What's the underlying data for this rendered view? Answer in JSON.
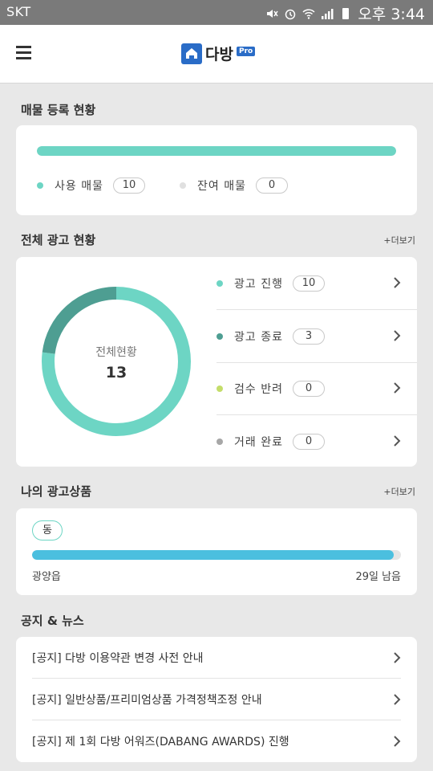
{
  "status_bar": {
    "carrier": "SKT",
    "time": "오후 3:44"
  },
  "header": {
    "logo_text": "다방",
    "logo_badge": "Pro"
  },
  "listing_status": {
    "title": "매물 등록 현황",
    "used_ratio": 1.0,
    "used": {
      "label": "사용 매물",
      "count": "10",
      "color": "#6dd5c4"
    },
    "remaining": {
      "label": "잔여 매물",
      "count": "0",
      "color": "#e0e0e0"
    }
  },
  "ad_status": {
    "title": "전체 광고 현황",
    "more": "+더보기",
    "center_label": "전체현황",
    "total": "13",
    "items": [
      {
        "label": "광고 진행",
        "count": "10",
        "value": 10,
        "color": "#6dd5c4"
      },
      {
        "label": "광고 종료",
        "count": "3",
        "value": 3,
        "color": "#4e9e92"
      },
      {
        "label": "검수 반려",
        "count": "0",
        "value": 0,
        "color": "#c4dd6a"
      },
      {
        "label": "거래 완료",
        "count": "0",
        "value": 0,
        "color": "#a7a7a7"
      }
    ]
  },
  "my_products": {
    "title": "나의 광고상품",
    "more": "+더보기",
    "tag": "동",
    "progress": 0.98,
    "area": "광양읍",
    "remaining": "29일 남음"
  },
  "news": {
    "title": "공지 & 뉴스",
    "items": [
      "[공지] 다방 이용약관 변경 사전 안내",
      "[공지] 일반상품/프리미엄상품 가격정책조정 안내",
      "[공지] 제 1회 다방 어워즈(DABANG AWARDS) 진행"
    ]
  }
}
